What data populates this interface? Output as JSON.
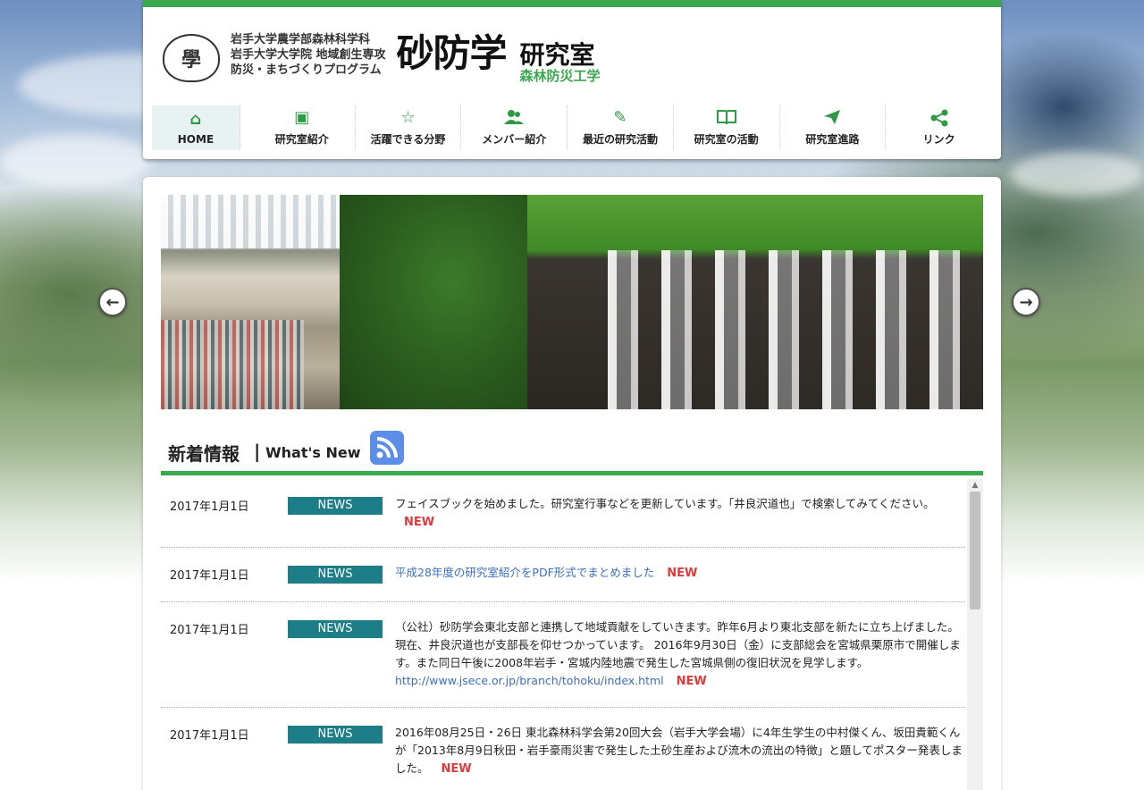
{
  "header": {
    "seal_text": "學",
    "university_lines": [
      "岩手大学農学部森林科学科",
      "岩手大学大学院 地域創生専攻",
      "防災・まちづくりプログラム"
    ],
    "title_main": "砂防学",
    "title_sub": "研究室",
    "title_sub2": "森林防災工学",
    "accent_color": "#3aa84f"
  },
  "nav": [
    {
      "label": "HOME",
      "icon": "home-icon",
      "glyph": "⌂",
      "active": true
    },
    {
      "label": "研究室紹介",
      "icon": "image-icon",
      "glyph": "▣",
      "active": false
    },
    {
      "label": "活躍できる分野",
      "icon": "star-icon",
      "glyph": "☆",
      "active": false
    },
    {
      "label": "メンバー紹介",
      "icon": "users-icon",
      "glyph": "👥",
      "active": false
    },
    {
      "label": "最近の研究活動",
      "icon": "pen-icon",
      "glyph": "✎",
      "active": false
    },
    {
      "label": "研究室の活動",
      "icon": "book-icon",
      "glyph": "📖",
      "active": false
    },
    {
      "label": "研究室進路",
      "icon": "send-icon",
      "glyph": "➤",
      "active": false
    },
    {
      "label": "リンク",
      "icon": "share-icon",
      "glyph": "⋖",
      "active": false
    }
  ],
  "slider": {
    "prev_glyph": "←",
    "next_glyph": "→"
  },
  "news": {
    "title_jp": "新着情報",
    "separator": "|",
    "title_en": "What's New",
    "items": [
      {
        "date": "2017年1月1日",
        "badge": "NEWS",
        "text": "フェイスブックを始めました。研究室行事などを更新しています。「井良沢道也」で検索してみてください。",
        "link": "",
        "new_label": "NEW"
      },
      {
        "date": "2017年1月1日",
        "badge": "NEWS",
        "text": "",
        "link": "平成28年度の研究室紹介をPDF形式でまとめました",
        "new_label": "NEW"
      },
      {
        "date": "2017年1月1日",
        "badge": "NEWS",
        "text": "（公社）砂防学会東北支部と連携して地域貢献をしていきます。昨年6月より東北支部を新たに立ち上げました。現在、井良沢道也が支部長を仰せつかっています。 2016年9月30日（金）に支部総会を宮城県栗原市で開催します。また同日午後に2008年岩手・宮城内陸地震で発生した宮城県側の復旧状況を見学します。",
        "link": "http://www.jsece.or.jp/branch/tohoku/index.html",
        "new_label": "NEW"
      },
      {
        "date": "2017年1月1日",
        "badge": "NEWS",
        "text": "2016年08月25日・26日 東北森林科学会第20回大会（岩手大学会場）に4年生学生の中村傑くん、坂田貴範くんが「2013年8月9日秋田・岩手豪雨災害で発生した土砂生産および流木の流出の特徴」と題してポスター発表しました。",
        "link": "",
        "new_label": "NEW"
      }
    ]
  }
}
